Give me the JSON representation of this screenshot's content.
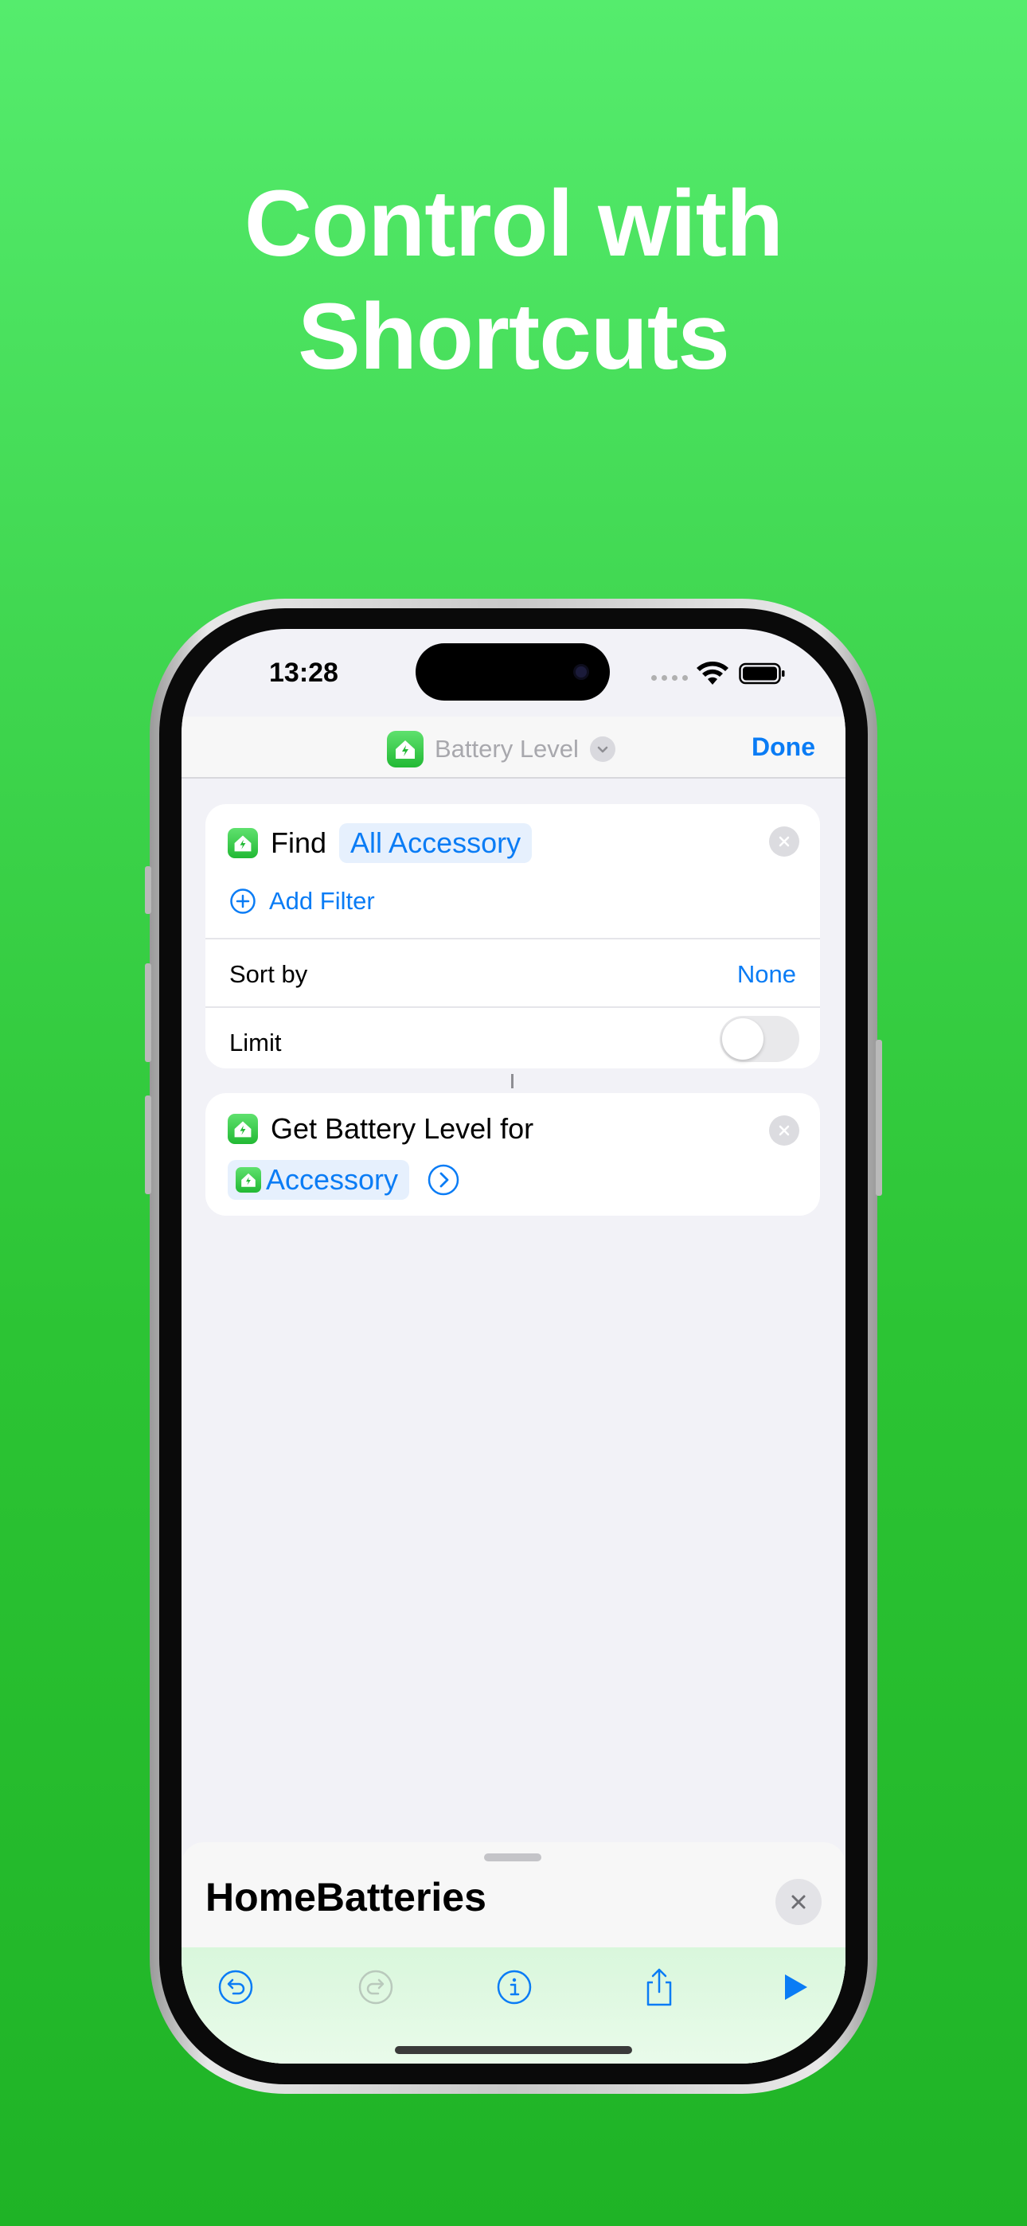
{
  "headline": {
    "line1": "Control with",
    "line2": "Shortcuts"
  },
  "status_bar": {
    "time": "13:28"
  },
  "nav": {
    "title": "Battery Level",
    "done_label": "Done"
  },
  "find_action": {
    "verb": "Find",
    "target": "All Accessory",
    "add_filter_label": "Add Filter",
    "sort_label": "Sort by",
    "sort_value": "None",
    "limit_label": "Limit",
    "limit_enabled": false
  },
  "battery_action": {
    "title": "Get Battery Level for",
    "parameter": "Accessory"
  },
  "sheet": {
    "title": "HomeBatteries"
  },
  "toolbar": {
    "items": [
      "undo-icon",
      "redo-icon",
      "info-icon",
      "share-icon",
      "play-icon"
    ]
  },
  "colors": {
    "accent": "#0a7cf5",
    "background_green": "#2cc434",
    "app_icon_green": "#22b934"
  }
}
